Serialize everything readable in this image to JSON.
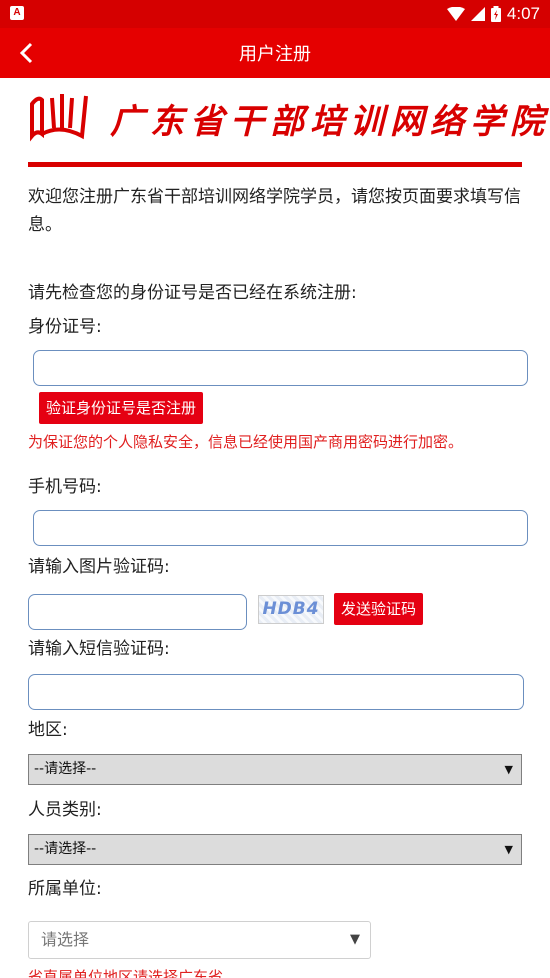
{
  "status_bar": {
    "time": "4:07",
    "app_badge": "A"
  },
  "header": {
    "title": "用户注册"
  },
  "logo": {
    "text": "广东省干部培训网络学院"
  },
  "intro_text": "欢迎您注册广东省干部培训网络学院学员，请您按页面要求填写信息。",
  "check_prompt": "请先检查您的身份证号是否已经在系统注册:",
  "id_number": {
    "label": "身份证号:",
    "value": "",
    "verify_button": "验证身份证号是否注册"
  },
  "privacy_note": "为保证您的个人隐私安全，信息已经使用国产商用密码进行加密。",
  "phone": {
    "label": "手机号码:",
    "value": ""
  },
  "image_captcha": {
    "label": "请输入图片验证码:",
    "value": "",
    "captcha_text": "HDB4",
    "send_button": "发送验证码"
  },
  "sms_code": {
    "label": "请输入短信验证码:",
    "value": ""
  },
  "region": {
    "label": "地区:",
    "selected": "--请选择--"
  },
  "personnel_type": {
    "label": "人员类别:",
    "selected": "--请选择--"
  },
  "unit": {
    "label": "所属单位:",
    "placeholder": "请选择"
  },
  "bottom_note": "省直属单位地区请选择广东省",
  "colors": {
    "brand_red": "#e50000",
    "input_border": "#6b8fbf",
    "warning_text": "#e02020"
  }
}
